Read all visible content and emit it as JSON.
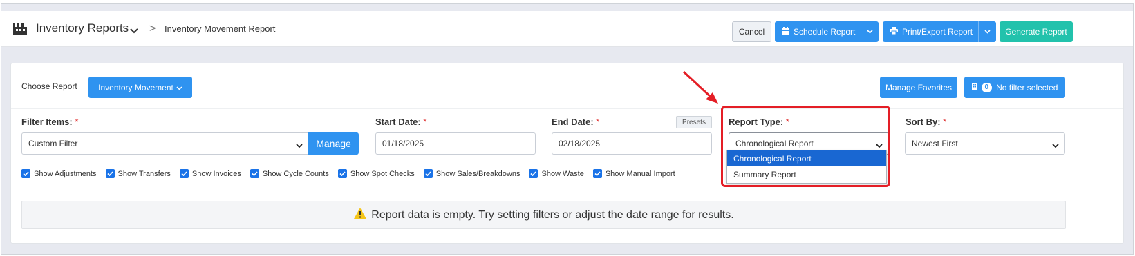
{
  "header": {
    "section_title": "Inventory Reports",
    "breadcrumb_separator": ">",
    "current_page": "Inventory Movement Report",
    "buttons": {
      "cancel": "Cancel",
      "schedule": "Schedule Report",
      "print_export": "Print/Export Report",
      "generate": "Generate Report"
    }
  },
  "report_bar": {
    "choose_label": "Choose Report",
    "selected_report": "Inventory Movement",
    "manage_favorites": "Manage Favorites",
    "filter_count": "0",
    "filter_status": "No filter selected"
  },
  "filters": {
    "filter_items": {
      "label": "Filter Items:",
      "value": "Custom Filter",
      "manage_button": "Manage"
    },
    "start_date": {
      "label": "Start Date:",
      "value": "01/18/2025"
    },
    "end_date": {
      "label": "End Date:",
      "value": "02/18/2025",
      "presets_button": "Presets"
    },
    "report_type": {
      "label": "Report Type:",
      "value": "Chronological Report",
      "options": [
        "Chronological Report",
        "Summary Report"
      ],
      "highlighted_option": "Chronological Report"
    },
    "sort_by": {
      "label": "Sort By:",
      "value": "Newest First"
    },
    "required_marker": "*"
  },
  "checkboxes": [
    {
      "label": "Show Adjustments",
      "checked": true
    },
    {
      "label": "Show Transfers",
      "checked": true
    },
    {
      "label": "Show Invoices",
      "checked": true
    },
    {
      "label": "Show Cycle Counts",
      "checked": true
    },
    {
      "label": "Show Spot Checks",
      "checked": true
    },
    {
      "label": "Show Sales/Breakdowns",
      "checked": true
    },
    {
      "label": "Show Waste",
      "checked": true
    },
    {
      "label": "Show Manual Import",
      "checked": true
    }
  ],
  "empty_message": "Report data is empty. Try setting filters or adjust the date range for results.",
  "colors": {
    "primary": "#2f93f0",
    "success": "#22c2ac",
    "annotation": "#e41e26",
    "selected_option": "#1967d2",
    "warning_icon": "#f5c518"
  },
  "icons": {
    "section": "factory-icon",
    "schedule": "calendar-icon",
    "print": "printer-icon",
    "filter": "filter-icon",
    "empty": "warning-icon"
  }
}
